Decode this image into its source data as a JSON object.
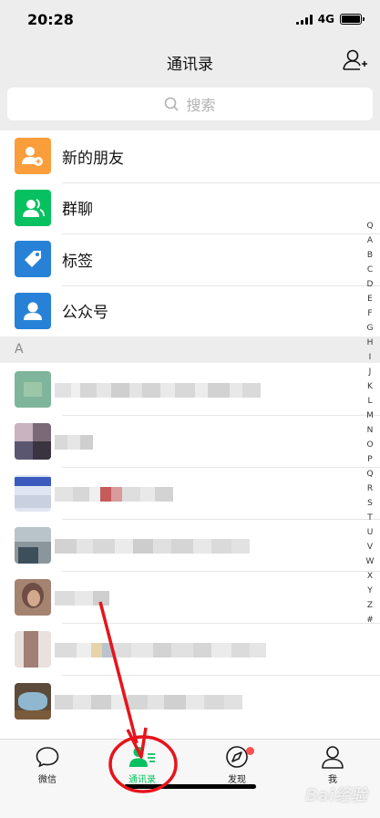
{
  "status": {
    "time": "20:28",
    "network": "4G"
  },
  "nav": {
    "title": "通讯录"
  },
  "search": {
    "placeholder": "搜索"
  },
  "fixed_items": [
    {
      "label": "新的朋友",
      "icon": "new-friend-icon",
      "color": "#fa9d3b"
    },
    {
      "label": "群聊",
      "icon": "group-chat-icon",
      "color": "#07c160"
    },
    {
      "label": "标签",
      "icon": "tag-icon",
      "color": "#2782d7"
    },
    {
      "label": "公众号",
      "icon": "official-account-icon",
      "color": "#2782d7"
    }
  ],
  "section": {
    "letter": "A"
  },
  "index_letters": [
    "Q",
    "A",
    "B",
    "C",
    "D",
    "E",
    "F",
    "G",
    "H",
    "I",
    "J",
    "K",
    "L",
    "M",
    "N",
    "O",
    "P",
    "Q",
    "R",
    "S",
    "T",
    "U",
    "V",
    "W",
    "X",
    "Y",
    "Z",
    "#"
  ],
  "contacts": [
    {
      "name": ""
    },
    {
      "name": ""
    },
    {
      "name": ""
    },
    {
      "name": ""
    },
    {
      "name": ""
    },
    {
      "name": ""
    },
    {
      "name": ""
    }
  ],
  "tabs": [
    {
      "label": "微信",
      "icon": "chat-bubble-icon",
      "active": false
    },
    {
      "label": "通讯录",
      "icon": "contacts-icon",
      "active": true
    },
    {
      "label": "发现",
      "icon": "compass-icon",
      "active": false,
      "badge": true
    },
    {
      "label": "我",
      "icon": "person-icon",
      "active": false
    }
  ],
  "colors": {
    "accent": "#07c160",
    "annotation": "#e8131b",
    "badge": "#fa5151"
  },
  "watermark": "Bai经验"
}
